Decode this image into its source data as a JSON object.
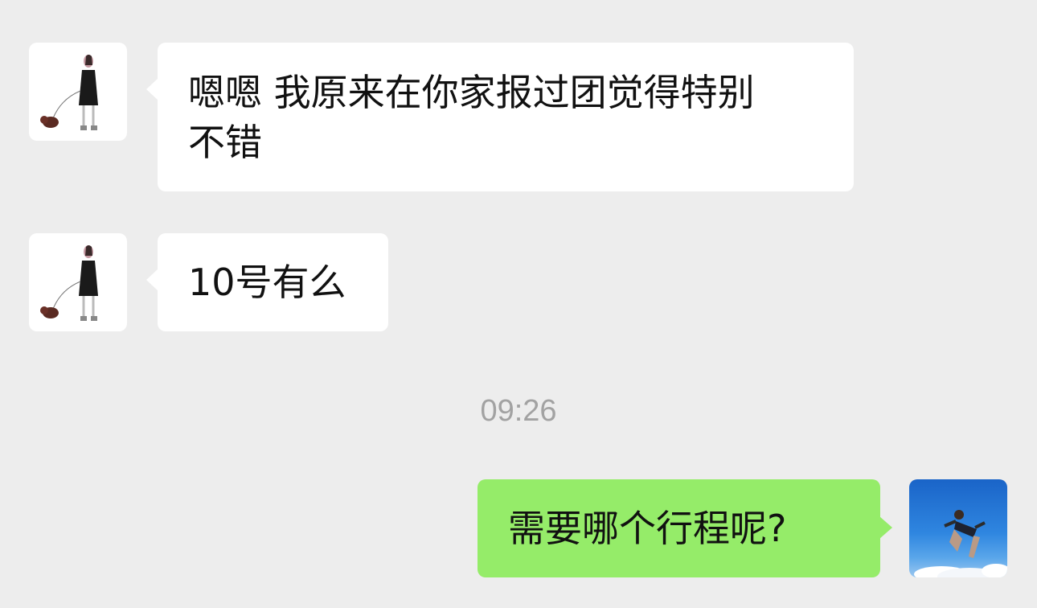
{
  "messages": [
    {
      "sender": "contact",
      "avatar_icon": "girl-walking-dog-avatar",
      "text_lines": [
        "嗯嗯 我原来在你家报过团觉得特别",
        "不错"
      ]
    },
    {
      "sender": "contact",
      "avatar_icon": "girl-walking-dog-avatar",
      "text": "10号有么"
    },
    {
      "sender": "me",
      "avatar_icon": "person-jumping-sky-avatar",
      "text": "需要哪个行程呢?"
    }
  ],
  "timestamp": "09:26",
  "colors": {
    "background": "#ededed",
    "incoming_bubble": "#ffffff",
    "outgoing_bubble": "#95ec69",
    "timestamp_text": "#a2a2a2"
  }
}
